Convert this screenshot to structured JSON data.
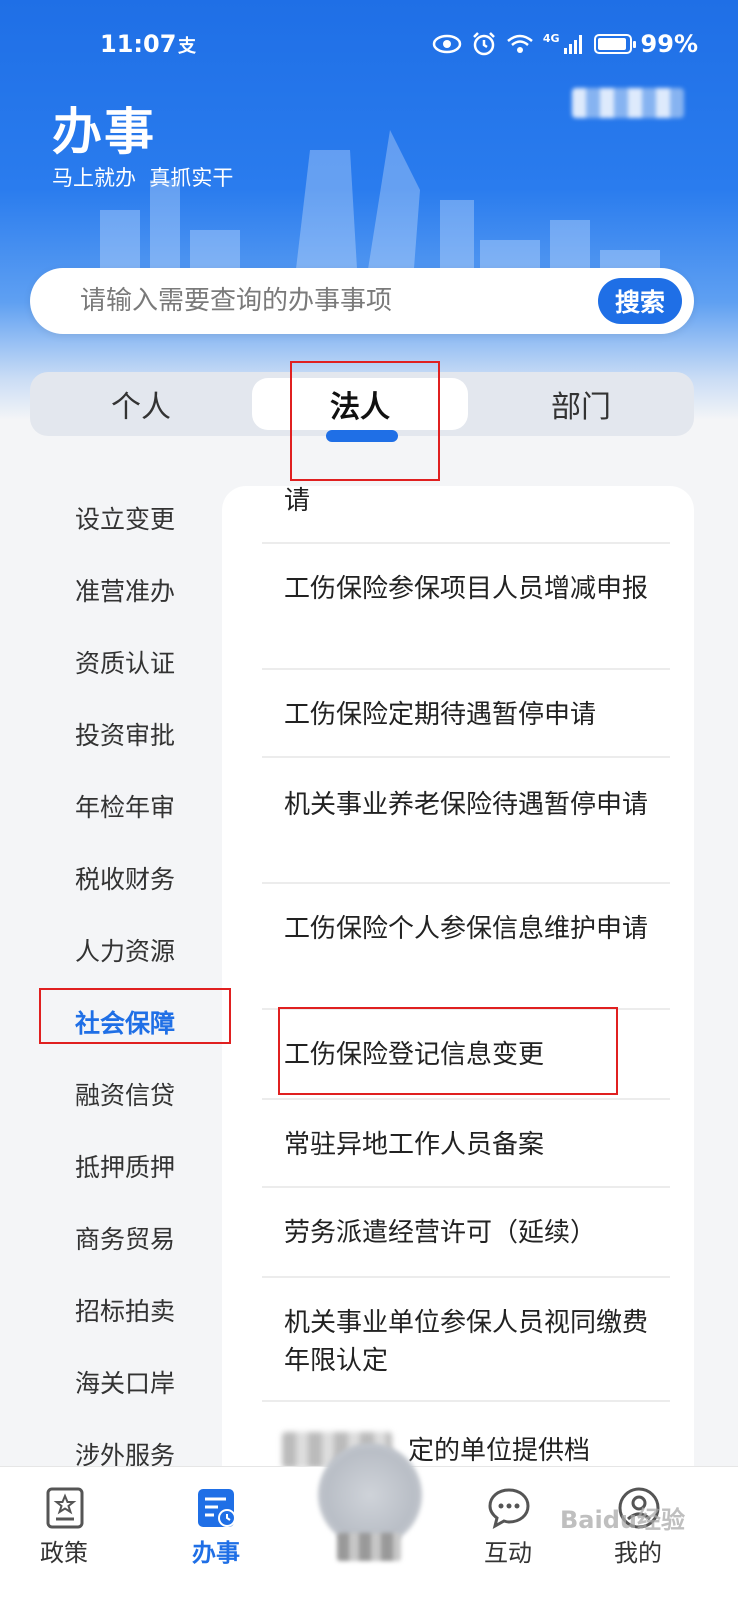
{
  "status_bar": {
    "time": "11:07",
    "carrier_icon": "支",
    "network": "4G",
    "battery": "99%"
  },
  "header": {
    "title": "办事",
    "slogan": "马上就办  真抓实干"
  },
  "search": {
    "placeholder": "请输入需要查询的办事事项",
    "button_label": "搜索"
  },
  "tabs": [
    {
      "label": "个人"
    },
    {
      "label": "法人"
    },
    {
      "label": "部门"
    }
  ],
  "active_tab": "法人",
  "categories": [
    {
      "label": "设立变更"
    },
    {
      "label": "准营准办"
    },
    {
      "label": "资质认证"
    },
    {
      "label": "投资审批"
    },
    {
      "label": "年检年审"
    },
    {
      "label": "税收财务"
    },
    {
      "label": "人力资源"
    },
    {
      "label": "社会保障"
    },
    {
      "label": "融资信贷"
    },
    {
      "label": "抵押质押"
    },
    {
      "label": "商务贸易"
    },
    {
      "label": "招标拍卖"
    },
    {
      "label": "海关口岸"
    },
    {
      "label": "涉外服务"
    }
  ],
  "active_category": "社会保障",
  "services": [
    {
      "label": "请"
    },
    {
      "label": "工伤保险参保项目人员增减申报"
    },
    {
      "label": "工伤保险定期待遇暂停申请"
    },
    {
      "label": "机关事业养老保险待遇暂停申请"
    },
    {
      "label": "工伤保险个人参保信息维护申请"
    },
    {
      "label": "工伤保险登记信息变更"
    },
    {
      "label": "常驻异地工作人员备案"
    },
    {
      "label": "劳务派遣经营许可（延续）"
    },
    {
      "label": "机关事业单位参保人员视同缴费年限认定"
    },
    {
      "label": "定的单位提供档"
    }
  ],
  "bottom_nav": [
    {
      "label": "政策",
      "icon": "policy-icon"
    },
    {
      "label": "办事",
      "icon": "affairs-icon"
    },
    {
      "label": "互动",
      "icon": "chat-icon"
    },
    {
      "label": "我的",
      "icon": "profile-icon"
    }
  ],
  "watermark": "Baidu经验",
  "colors": {
    "brand": "#1f6fe6",
    "annotation": "#e02020"
  }
}
